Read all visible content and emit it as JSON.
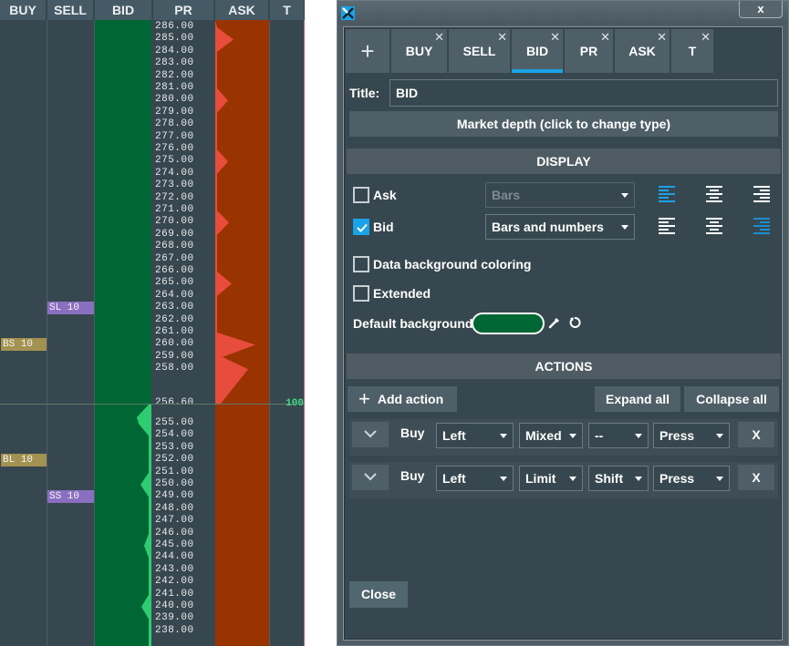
{
  "ladder": {
    "columns": [
      "BUY",
      "SELL",
      "BID",
      "PR",
      "ASK",
      "T"
    ],
    "prices_above": [
      "286.00",
      "285.00",
      "284.00",
      "283.00",
      "282.00",
      "281.00",
      "280.00",
      "279.00",
      "278.00",
      "277.00",
      "276.00",
      "275.00",
      "274.00",
      "273.00",
      "272.00",
      "271.00",
      "270.00",
      "269.00",
      "268.00",
      "267.00",
      "266.00",
      "265.00",
      "264.00",
      "263.00",
      "262.00",
      "261.00",
      "260.00",
      "259.00",
      "258.00"
    ],
    "last_price": "256.60",
    "prices_below": [
      "255.00",
      "254.00",
      "253.00",
      "252.00",
      "251.00",
      "250.00",
      "249.00",
      "248.00",
      "247.00",
      "246.00",
      "245.00",
      "244.00",
      "243.00",
      "242.00",
      "241.00",
      "240.00",
      "239.00",
      "238.00"
    ],
    "last_volume": "100",
    "orders": [
      {
        "label": "SL 10",
        "side": "sell",
        "price": "263.00"
      },
      {
        "label": "BS 10",
        "side": "buy",
        "price": "260.00"
      },
      {
        "label": "BL 10",
        "side": "buy",
        "price": "252.00"
      },
      {
        "label": "SS 10",
        "side": "sell",
        "price": "249.00"
      }
    ],
    "colors": {
      "bid_bg": "#006633",
      "bid_bar": "#2ecc71",
      "ask_bg": "#993300",
      "ask_bar": "#e74c3c",
      "volume": "#3ddc84"
    }
  },
  "dialog": {
    "tabs": [
      {
        "label": "+",
        "closable": false
      },
      {
        "label": "BUY",
        "closable": true
      },
      {
        "label": "SELL",
        "closable": true
      },
      {
        "label": "BID",
        "closable": true,
        "active": true
      },
      {
        "label": "PR",
        "closable": true
      },
      {
        "label": "ASK",
        "closable": true
      },
      {
        "label": "T",
        "closable": true
      }
    ],
    "tab_close_glyph": "✕",
    "window_close": "x",
    "title_label": "Title:",
    "title_value": "BID",
    "type_button": "Market depth (click to change type)",
    "display_header": "DISPLAY",
    "display": {
      "ask": {
        "label": "Ask",
        "checked": false,
        "mode": "Bars",
        "disabled": true,
        "alignment": "left"
      },
      "bid": {
        "label": "Bid",
        "checked": true,
        "mode": "Bars and numbers",
        "disabled": false,
        "alignment": "right"
      },
      "data_bg_coloring": {
        "label": "Data background coloring",
        "checked": false
      },
      "extended": {
        "label": "Extended",
        "checked": false
      },
      "default_background_label": "Default background",
      "default_background_color": "#006633"
    },
    "actions_header": "ACTIONS",
    "add_action": "Add action",
    "expand_all": "Expand all",
    "collapse_all": "Collapse all",
    "actions": [
      {
        "action": "Buy",
        "button": "Left",
        "order_type": "Mixed",
        "modifier": "--",
        "event": "Press",
        "remove": "X"
      },
      {
        "action": "Buy",
        "button": "Left",
        "order_type": "Limit",
        "modifier": "Shift",
        "event": "Press",
        "remove": "X"
      }
    ],
    "close_button": "Close",
    "accent_color": "#1aa3e8"
  }
}
